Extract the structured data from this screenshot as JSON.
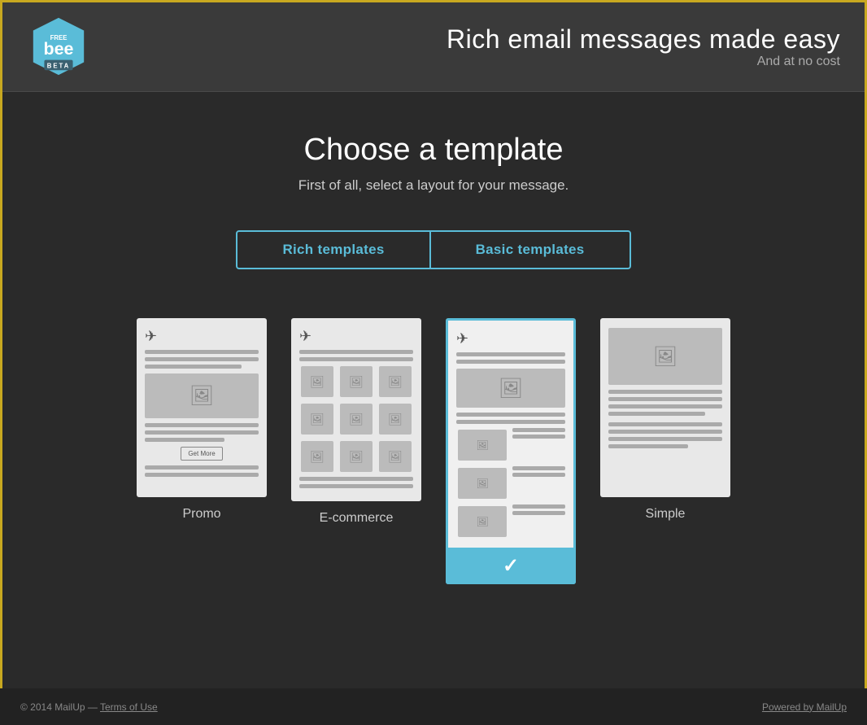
{
  "header": {
    "logo_text": "bee",
    "logo_free": "FREE",
    "logo_beta": "BETA",
    "title": "Rich email messages made easy",
    "subtitle": "And at no cost"
  },
  "main": {
    "page_title": "Choose a template",
    "page_subtitle": "First of all, select a layout for your message.",
    "tabs": [
      {
        "id": "rich",
        "label": "Rich templates",
        "active": true
      },
      {
        "id": "basic",
        "label": "Basic templates",
        "active": false
      }
    ],
    "templates": [
      {
        "id": "promo",
        "label": "Promo",
        "selected": false
      },
      {
        "id": "ecommerce",
        "label": "E-commerce",
        "selected": false
      },
      {
        "id": "newsletter",
        "label": "",
        "selected": true
      },
      {
        "id": "simple",
        "label": "Simple",
        "selected": false
      }
    ]
  },
  "footer": {
    "copyright": "© 2014 MailUp — ",
    "terms_label": "Terms of Use",
    "powered_label": "Powered by MailUp"
  }
}
